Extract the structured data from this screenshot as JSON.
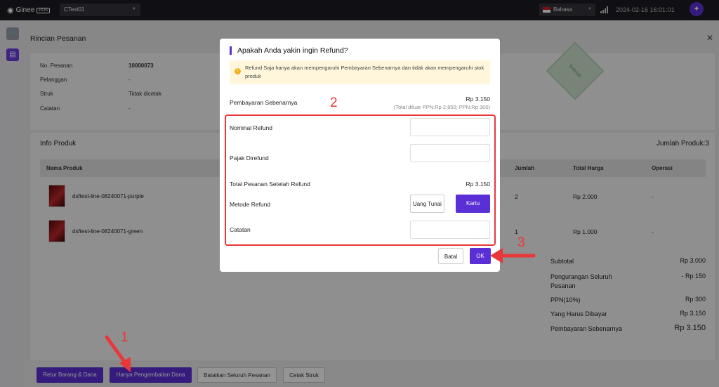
{
  "topbar": {
    "brand": "Ginee",
    "brand_tag": "POS",
    "store": "CTest01",
    "language": "Bahasa",
    "datetime": "2024-02-16 16:01:01"
  },
  "page": {
    "title": "Rincian Pesanan"
  },
  "order_info": [
    {
      "label": "No. Pesanan",
      "value": "10000073"
    },
    {
      "label": "Pelanggan",
      "value": "-"
    },
    {
      "label": "Struk",
      "value": "Tidak dicetak"
    },
    {
      "label": "Catatan",
      "value": "-"
    }
  ],
  "stamp": "Selesai",
  "products": {
    "title": "Info Produk",
    "count_label": "Jumlah Produk:3",
    "headers": {
      "name": "Nama Produk",
      "qty": "Jumlah",
      "total": "Total Harga",
      "op": "Operasi"
    },
    "rows": [
      {
        "name": "dsftest-line-08240071-purple",
        "qty": "2",
        "total": "Rp 2.000",
        "op": "-"
      },
      {
        "name": "dsftest-line-08240071-green",
        "qty": "1",
        "total": "Rp 1.000",
        "op": "-"
      }
    ]
  },
  "summary": [
    {
      "label": "Subtotal",
      "value": "Rp 3.000"
    },
    {
      "label": "Pengurangan Seluruh Pesanan",
      "value": "- Rp 150"
    },
    {
      "label": "PPN(10%)",
      "value": "Rp 300"
    },
    {
      "label": "Yang Harus Dibayar",
      "value": "Rp 3.150"
    },
    {
      "label": "Pembayaran Sebenarnya",
      "value": "Rp 3.150"
    }
  ],
  "bottom_buttons": [
    "Retur Barang & Dana",
    "Hanya Pengembalian Dana",
    "Batalkan Seluruh Pesanan",
    "Cetak Struk"
  ],
  "modal": {
    "title": "Apakah Anda yakin ingin Refund?",
    "warning": "Refund Saja hanya akan mempengaruhi Pembayaran Sebenarnya dan tidak akan mempengaruhi stok produk",
    "actual_payment_label": "Pembayaran Sebenarnya",
    "actual_payment_value": "Rp 3.150",
    "actual_payment_note": "(Total diluar PPN:Rp 2.850; PPN:Rp 300)",
    "nominal_label": "Nominal Refund",
    "nominal_value": "",
    "tax_label": "Pajak Direfund",
    "tax_value": "",
    "total_after_label": "Total Pesanan Setelah Refund",
    "total_after_value": "Rp 3.150",
    "method_label": "Metode Refund",
    "method_cash": "Uang Tunai",
    "method_card": "Kartu",
    "note_label": "Catatan",
    "note_value": "",
    "cancel": "Batal",
    "ok": "OK"
  },
  "annotations": {
    "one": "1",
    "two": "2",
    "three": "3"
  },
  "colors": {
    "accent": "#5b2fd6",
    "annotation": "#e8383a",
    "topbar": "#1c1c24"
  }
}
